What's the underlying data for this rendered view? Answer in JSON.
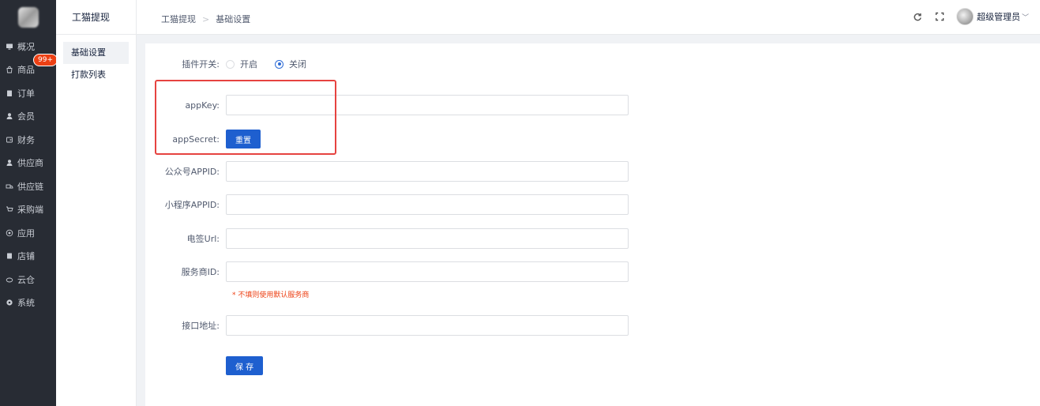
{
  "sidebar": {
    "items": [
      {
        "label": "概况",
        "icon": "monitor-icon"
      },
      {
        "label": "商品",
        "icon": "shopping-bag-icon",
        "badge": "99+"
      },
      {
        "label": "订单",
        "icon": "clipboard-icon"
      },
      {
        "label": "会员",
        "icon": "user-icon"
      },
      {
        "label": "财务",
        "icon": "wallet-icon"
      },
      {
        "label": "供应商",
        "icon": "supplier-icon"
      },
      {
        "label": "供应链",
        "icon": "truck-icon"
      },
      {
        "label": "采购端",
        "icon": "cart-icon"
      },
      {
        "label": "应用",
        "icon": "apps-icon"
      },
      {
        "label": "店铺",
        "icon": "store-icon"
      },
      {
        "label": "云仓",
        "icon": "cloud-icon"
      },
      {
        "label": "系统",
        "icon": "gear-icon"
      }
    ]
  },
  "submenu": {
    "title": "工猫提现",
    "items": [
      {
        "label": "基础设置",
        "active": true
      },
      {
        "label": "打款列表",
        "active": false
      }
    ]
  },
  "header": {
    "breadcrumb": [
      "工猫提现",
      "基础设置"
    ],
    "user_name": "超级管理员"
  },
  "form": {
    "plugin_switch": {
      "label": "插件开关:",
      "options": [
        "开启",
        "关闭"
      ],
      "selected": "关闭"
    },
    "app_key": {
      "label": "appKey:",
      "value": ""
    },
    "app_secret": {
      "label": "appSecret:",
      "button": "重置"
    },
    "official_appid": {
      "label": "公众号APPID:",
      "value": ""
    },
    "mini_appid": {
      "label": "小程序APPID:",
      "value": ""
    },
    "esign_url": {
      "label": "电签Url:",
      "value": ""
    },
    "provider_id": {
      "label": "服务商ID:",
      "value": "",
      "hint": "* 不填则使用默认服务商"
    },
    "api_url": {
      "label": "接口地址:",
      "value": ""
    },
    "save_button": "保 存"
  },
  "colors": {
    "primary": "#1e5fcf",
    "highlight_border": "#e64340",
    "sidebar_bg": "#282c34",
    "badge": "#ed4014"
  }
}
